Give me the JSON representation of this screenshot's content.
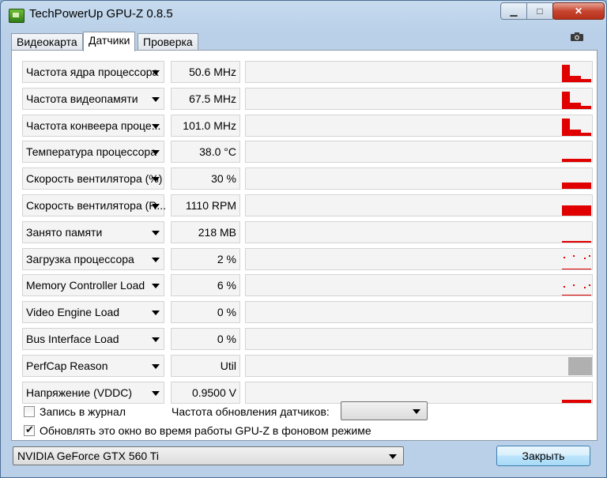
{
  "window": {
    "title": "TechPowerUp GPU-Z 0.8.5"
  },
  "title_buttons": {
    "minimize": "▁",
    "maximize": "□",
    "close": "✕"
  },
  "tabs": [
    {
      "label": "Видеокарта"
    },
    {
      "label": "Датчики"
    },
    {
      "label": "Проверка"
    }
  ],
  "sensors": [
    {
      "label": "Частота ядра процессора",
      "value": "50.6 MHz",
      "graph": "step-high"
    },
    {
      "label": "Частота видеопамяти",
      "value": "67.5 MHz",
      "graph": "step-high"
    },
    {
      "label": "Частота конвеера проце...",
      "value": "101.0 MHz",
      "graph": "step-high"
    },
    {
      "label": "Температура процессора",
      "value": "38.0 °C",
      "graph": "low-bar"
    },
    {
      "label": "Скорость вентилятора (%)",
      "value": "30 %",
      "graph": "mid-bar"
    },
    {
      "label": "Скорость вентилятора (R...",
      "value": "1110 RPM",
      "graph": "tall-bar"
    },
    {
      "label": "Занято памяти",
      "value": "218 MB",
      "graph": "line"
    },
    {
      "label": "Загрузка процессора",
      "value": "2 %",
      "graph": "dots"
    },
    {
      "label": "Memory Controller Load",
      "value": "6 %",
      "graph": "dots-low"
    },
    {
      "label": "Video Engine Load",
      "value": "0 %",
      "graph": "empty"
    },
    {
      "label": "Bus Interface Load",
      "value": "0 %",
      "graph": "empty"
    },
    {
      "label": "PerfCap Reason",
      "value": "Util",
      "graph": "perfcap"
    },
    {
      "label": "Напряжение (VDDC)",
      "value": "0.9500 V",
      "graph": "low-bar"
    }
  ],
  "options": {
    "log_label": "Запись в журнал",
    "log_checked": false,
    "refresh_label": "Частота обновления датчиков:",
    "refresh_value": "",
    "background_label": "Обновлять это окно во время работы GPU-Z в фоновом режиме",
    "background_checked": true
  },
  "footer": {
    "gpu_select": "NVIDIA GeForce GTX 560 Ti",
    "close_button": "Закрыть"
  },
  "colors": {
    "graph": "#e00000",
    "perfcap": "#b0b0b0"
  }
}
